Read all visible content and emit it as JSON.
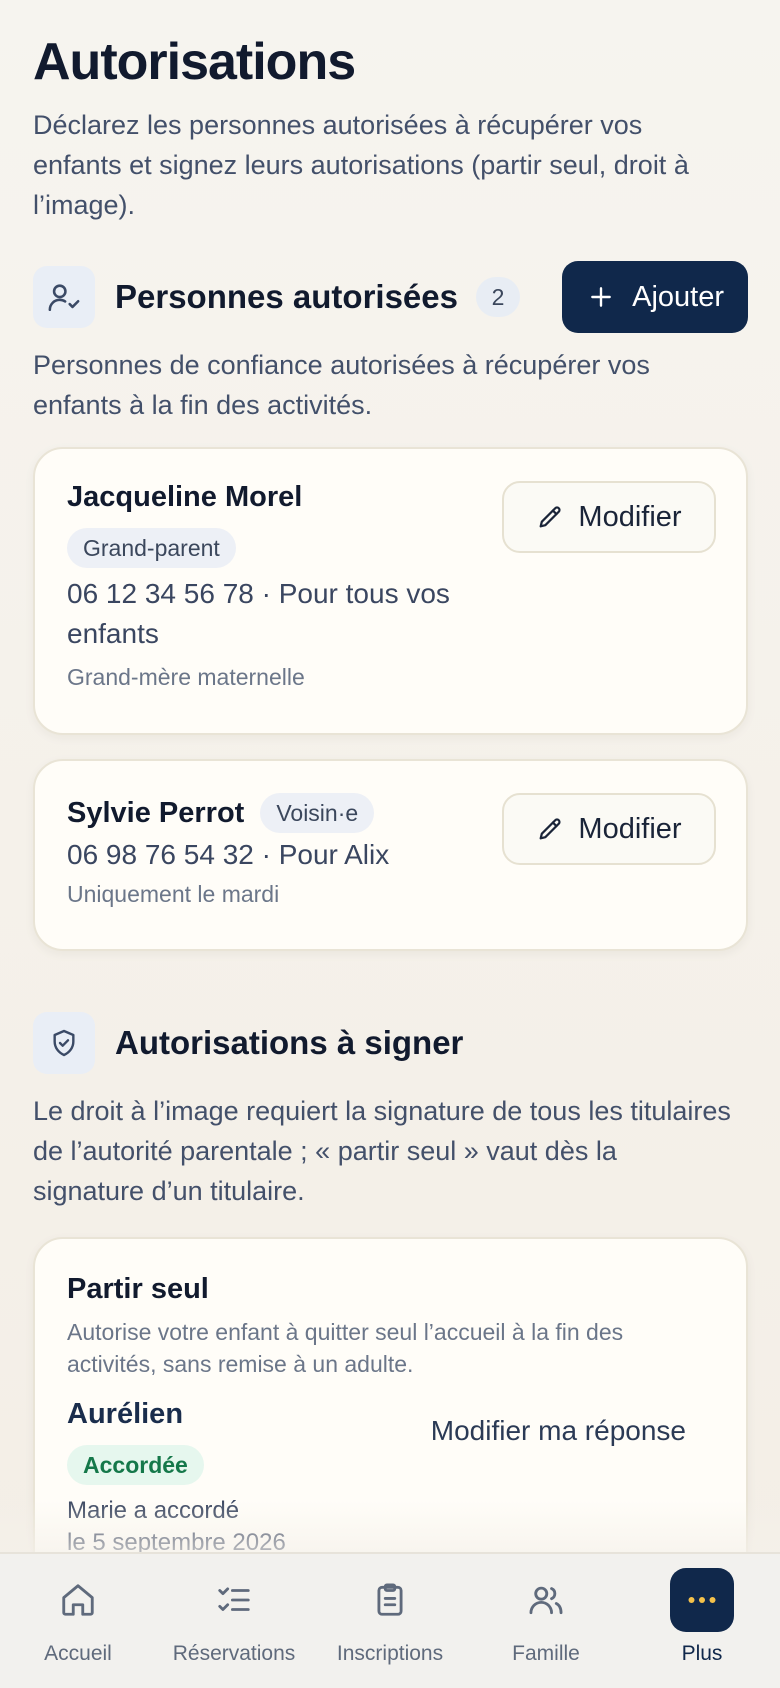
{
  "header": {
    "title": "Autorisations",
    "intro": "Déclarez les personnes autorisées à récupérer vos enfants et signez leurs autorisations (partir seul, droit à l’image)."
  },
  "authorized": {
    "title": "Personnes autorisées",
    "count": "2",
    "add_label": "Ajouter",
    "description": "Personnes de confiance autorisées à récupérer vos enfants à la fin des activités.",
    "edit_label": "Modifier",
    "people": [
      {
        "name": "Jacqueline Morel",
        "role": "Grand-parent",
        "info": "06 12 34 56 78 · Pour tous vos enfants",
        "note": "Grand-mère maternelle"
      },
      {
        "name": "Sylvie Perrot",
        "role": "Voisin·e",
        "info": "06 98 76 54 32 · Pour Alix",
        "note": "Uniquement le mardi"
      }
    ]
  },
  "signatures": {
    "title": "Autorisations à signer",
    "description": "Le droit à l’image requiert la signature de tous les titulaires de l’autorité parentale ; « partir seul » vaut dès la signature d’un titulaire.",
    "items": [
      {
        "title": "Partir seul",
        "description": "Autorise votre enfant à quitter seul l’accueil à la fin des activités, sans remise à un adulte.",
        "child": "Aurélien",
        "status": "Accordée",
        "signed_by": "Marie a accordé",
        "signed_on": "le 5 septembre 2026",
        "action_label": "Modifier ma réponse"
      }
    ]
  },
  "nav": {
    "items": [
      {
        "label": "Accueil",
        "icon": "home-icon"
      },
      {
        "label": "Réservations",
        "icon": "checklist-icon"
      },
      {
        "label": "Inscriptions",
        "icon": "clipboard-icon"
      },
      {
        "label": "Famille",
        "icon": "users-icon"
      },
      {
        "label": "Plus",
        "icon": "more-icon"
      }
    ],
    "active": "Plus"
  },
  "colors": {
    "primary": "#10284b",
    "success_bg": "#e6f7ee",
    "success_text": "#15784a",
    "card_bg": "#fffdf8"
  }
}
